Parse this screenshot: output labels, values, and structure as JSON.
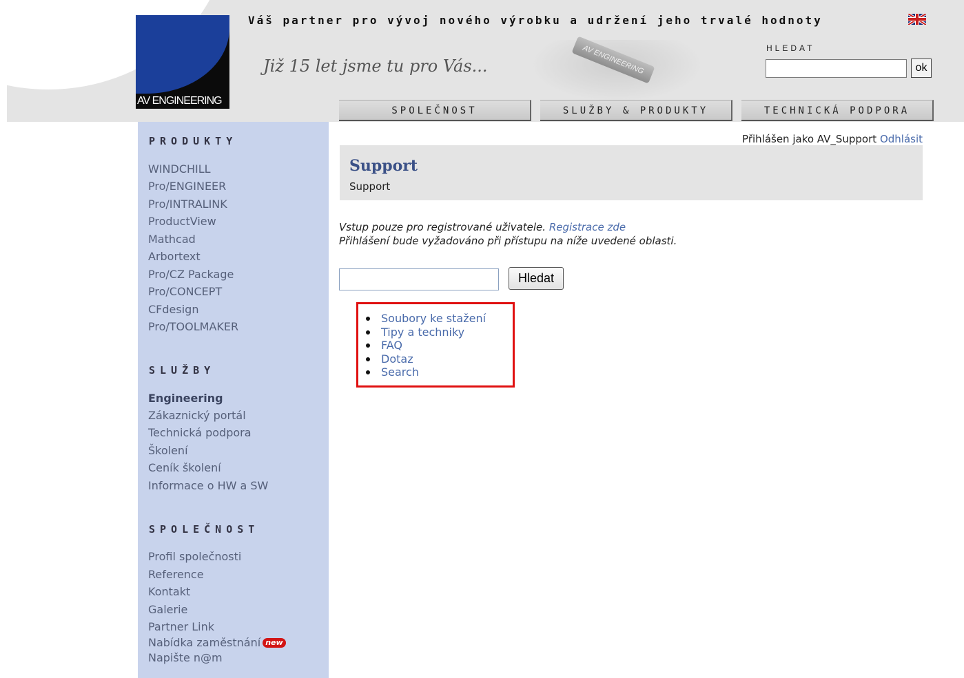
{
  "header": {
    "logo_text": "AV ENGINEERING",
    "tagline": "Váš partner pro vývoj nového výrobku a udržení jeho trvalé hodnoty",
    "years_text": "Již 15 let jsme tu pro Vás...",
    "car_plate_text": "AV ENGINEERING",
    "search_label": "HLEDAT",
    "search_value": "",
    "ok_label": "ok"
  },
  "nav": {
    "tabs": [
      {
        "label": "SPOLEČNOST"
      },
      {
        "label": "SLUŽBY & PRODUKTY"
      },
      {
        "label": "TECHNICKÁ PODPORA"
      }
    ]
  },
  "sidebar": {
    "products_heading": "PRODUKTY",
    "products": [
      "WINDCHILL",
      "Pro/ENGINEER",
      "Pro/INTRALINK",
      "ProductView",
      "Mathcad",
      "Arbortext",
      "Pro/CZ Package",
      "Pro/CONCEPT",
      "CFdesign",
      "Pro/TOOLMAKER"
    ],
    "services_heading": "SLUŽBY",
    "services": [
      "Engineering",
      "Zákaznický portál",
      "Technická podpora",
      "Školení",
      "Ceník školení",
      "Informace o HW a SW"
    ],
    "company_heading": "SPOLEČNOST",
    "company": [
      "Profil společnosti",
      "Reference",
      "Kontakt",
      "Galerie",
      "Partner Link",
      "Nabídka zaměstnání",
      "Napište n@m"
    ],
    "new_badge": "new"
  },
  "main": {
    "logged_in_prefix": "Přihlášen jako AV_Support",
    "logout_label": "Odhlásit",
    "title": "Support",
    "subtitle": "Support",
    "info_line1": "Vstup pouze pro registrované uživatele.",
    "register_link": "Registrace zde",
    "info_line2": "Přihlášení bude vyžadováno při přístupu na níže uvedené oblasti.",
    "search_value": "",
    "search_button": "Hledat",
    "links": [
      "Soubory ke stažení",
      "Tipy a techniky",
      "FAQ",
      "Dotaz",
      "Search"
    ]
  },
  "colors": {
    "sidebar_bg": "#c8d3ec",
    "header_bg": "#e4e4e4",
    "link": "#4a6bab",
    "title": "#3b5187",
    "highlight_border": "#e01010",
    "logo_blue": "#1b3f9a"
  }
}
